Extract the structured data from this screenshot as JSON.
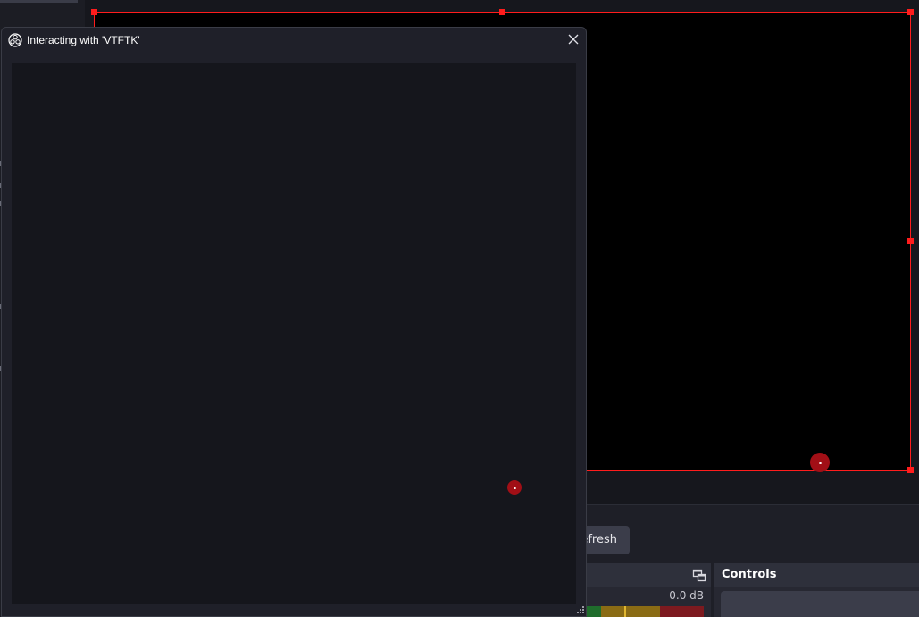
{
  "dialog": {
    "title": "Interacting with 'VTFTK'",
    "icon": "obs-logo-icon",
    "close_icon": "close-icon"
  },
  "main_window": {
    "refresh_label": "efresh",
    "mixer": {
      "level_label": "0.0 dB",
      "popout_icon": "popout-icon"
    },
    "controls": {
      "title": "Controls"
    }
  },
  "colors": {
    "selection": "#ff1c1c",
    "cursor": "#a10f16",
    "canvas": "#000000",
    "dialog_bg": "#1f2029",
    "browser_bg": "#15161c",
    "meter_green": "#1f6d2c",
    "meter_yellow": "#8a6b14",
    "meter_red": "#7d1a1f"
  }
}
